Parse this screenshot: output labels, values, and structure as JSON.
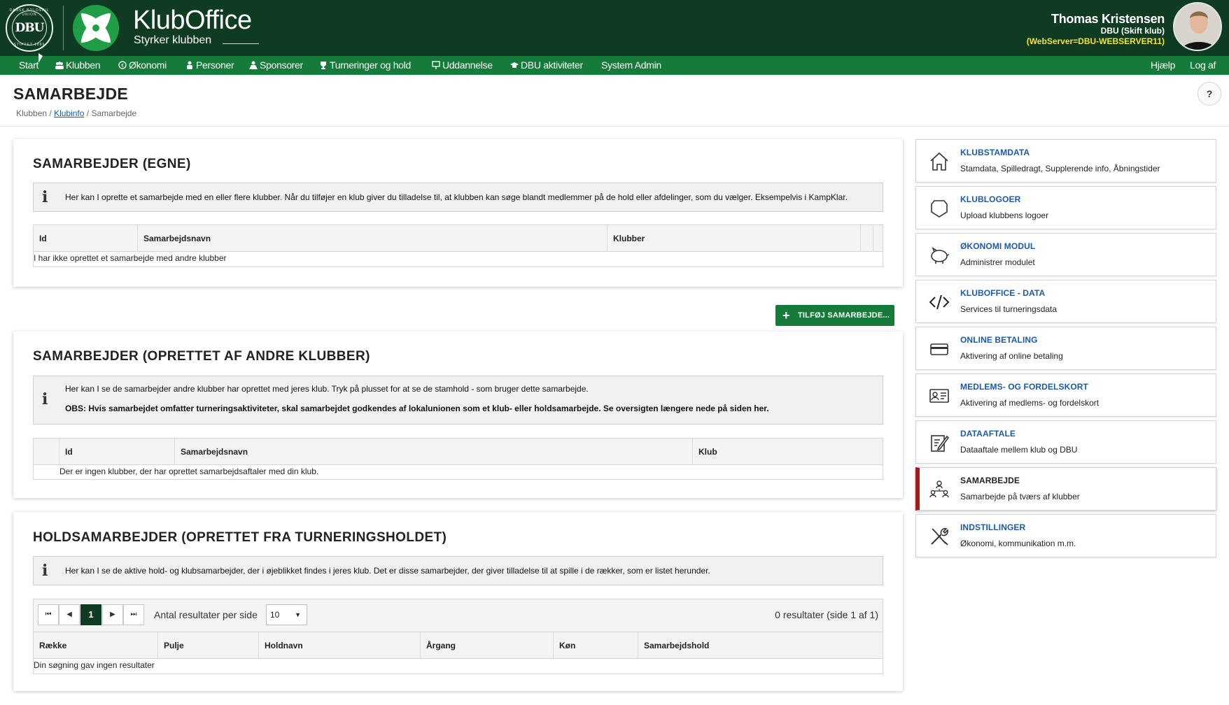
{
  "header": {
    "dbu_logo_text": "DBU",
    "dbu_ring_top": "DANSK BOLDSPIL UNION",
    "dbu_ring_bottom": "STIFTET 1889",
    "app_name": "KlubOffice",
    "tagline": "Styrker klubben",
    "user_name": "Thomas Kristensen",
    "user_club": "DBU (Skift klub)",
    "server": "(WebServer=DBU-WEBSERVER11)"
  },
  "nav": {
    "items": [
      "Start",
      "Klubben",
      "Økonomi",
      "Personer",
      "Sponsorer",
      "Turneringer og hold",
      "Uddannelse",
      "DBU aktiviteter",
      "System Admin"
    ],
    "help": "Hjælp",
    "logout": "Log af"
  },
  "page": {
    "title": "SAMARBEJDE",
    "breadcrumb": [
      "Klubben",
      "Klubinfo",
      "Samarbejde"
    ],
    "help_button": "?"
  },
  "section_own": {
    "title": "SAMARBEJDER (EGNE)",
    "info": "Her kan I oprette et samarbejde med en eller flere klubber. Når du tilføjer en klub giver du tilladelse til, at klubben kan søge blandt medlemmer på de hold eller afdelinger, som du vælger. Eksempelvis i KampKlar.",
    "columns": [
      "Id",
      "Samarbejdsnavn",
      "Klubber"
    ],
    "empty": "I har ikke oprettet et samarbejde med andre klubber",
    "add_button": "TILFØJ SAMARBEJDE..."
  },
  "section_others": {
    "title": "SAMARBEJDER (OPRETTET AF ANDRE KLUBBER)",
    "info": "Her kan I se de samarbejder andre klubber har oprettet med jeres klub. Tryk på plusset for at se de stamhold - som bruger dette samarbejde.",
    "info_bold": "OBS: Hvis samarbejdet omfatter turneringsaktiviteter, skal samarbejdet godkendes af lokalunionen som et klub- eller holdsamarbejde. Se oversigten længere nede på siden her.",
    "columns": [
      "Id",
      "Samarbejdsnavn",
      "Klub"
    ],
    "empty": "Der er ingen klubber, der har oprettet samarbejdsaftaler med din klub."
  },
  "section_team": {
    "title": "HOLDSAMARBEJDER (OPRETTET FRA TURNERINGSHOLDET)",
    "info": "Her kan I se de aktive hold- og klubsamarbejder, der i øjeblikket findes i jeres klub. Det er disse samarbejder, der giver tilladelse til at spille i de rækker, som er listet herunder.",
    "pager": {
      "current_page": "1",
      "per_page_label": "Antal resultater per side",
      "per_page_value": "10",
      "result_text": "0 resultater (side 1 af 1)"
    },
    "columns": [
      "Række",
      "Pulje",
      "Holdnavn",
      "Årgang",
      "Køn",
      "Samarbejdshold"
    ],
    "empty": "Din søgning gav ingen resultater"
  },
  "sidebar": [
    {
      "title": "KLUBSTAMDATA",
      "desc": "Stamdata, Spilledragt, Supplerende info, Åbningstider",
      "icon": "house-icon"
    },
    {
      "title": "KLUBLOGOER",
      "desc": "Upload klubbens logoer",
      "icon": "shield-icon"
    },
    {
      "title": "ØKONOMI MODUL",
      "desc": "Administrer modulet",
      "icon": "piggy-bank-icon"
    },
    {
      "title": "KLUBOFFICE - DATA",
      "desc": "Services til turneringsdata",
      "icon": "code-icon"
    },
    {
      "title": "ONLINE BETALING",
      "desc": "Aktivering af online betaling",
      "icon": "credit-card-icon"
    },
    {
      "title": "MEDLEMS- OG FORDELSKORT",
      "desc": "Aktivering af medlems- og fordelskort",
      "icon": "id-card-icon"
    },
    {
      "title": "DATAAFTALE",
      "desc": "Dataaftale mellem klub og DBU",
      "icon": "edit-document-icon"
    },
    {
      "title": "SAMARBEJDE",
      "desc": "Samarbejde på tværs af klubber",
      "icon": "people-network-icon"
    },
    {
      "title": "INDSTILLINGER",
      "desc": "Økonomi, kommunikation m.m.",
      "icon": "tools-icon"
    }
  ],
  "colors": {
    "header_dark": "#0f3b22",
    "nav_green": "#157a3a",
    "link_blue": "#1c5aa8",
    "active_marker": "#a31b1b",
    "server_yellow": "#f4e232"
  }
}
